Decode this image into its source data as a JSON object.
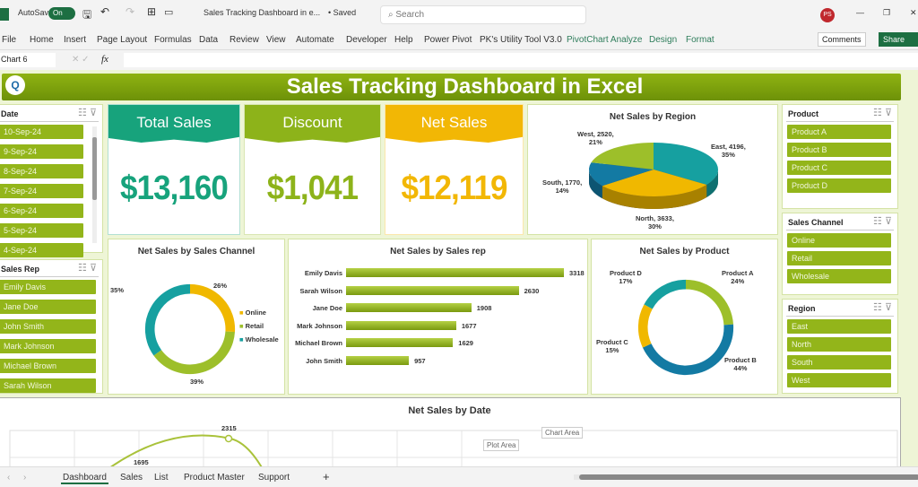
{
  "titlebar": {
    "app_icon": "excel-icon",
    "autosave_label": "AutoSave",
    "autosave_state": "On",
    "doc_title": "Sales Tracking Dashboard in e...",
    "saved_status": "• Saved",
    "search_placeholder": "Search",
    "user_initials": "PS"
  },
  "ribbon": {
    "tabs": [
      "File",
      "Home",
      "Insert",
      "Page Layout",
      "Formulas",
      "Data",
      "Review",
      "View",
      "Automate",
      "Developer",
      "Help",
      "Power Pivot",
      "PK's Utility Tool V3.0",
      "PivotChart Analyze",
      "Design",
      "Format"
    ],
    "comments": "Comments",
    "share": "Share"
  },
  "formula_bar": {
    "name_box": "Chart 6",
    "fx": "fx",
    "value": ""
  },
  "dashboard": {
    "title": "Sales Tracking Dashboard in Excel",
    "logo": "QA",
    "kpis": [
      {
        "label": "Total Sales",
        "value": "$13,160",
        "color": "#17a37c"
      },
      {
        "label": "Discount",
        "value": "$1,041",
        "color": "#8db31a"
      },
      {
        "label": "Net Sales",
        "value": "$12,119",
        "color": "#f2b705"
      }
    ],
    "slicers": {
      "date": {
        "header": "Date",
        "items": [
          "10-Sep-24",
          "9-Sep-24",
          "8-Sep-24",
          "7-Sep-24",
          "6-Sep-24",
          "5-Sep-24",
          "4-Sep-24"
        ]
      },
      "sales_rep": {
        "header": "Sales Rep",
        "items": [
          "Emily Davis",
          "Jane Doe",
          "John Smith",
          "Mark Johnson",
          "Michael Brown",
          "Sarah Wilson"
        ]
      },
      "product": {
        "header": "Product",
        "items": [
          "Product A",
          "Product B",
          "Product C",
          "Product D"
        ]
      },
      "sales_channel": {
        "header": "Sales Channel",
        "items": [
          "Online",
          "Retail",
          "Wholesale"
        ]
      },
      "region": {
        "header": "Region",
        "items": [
          "East",
          "North",
          "South",
          "West"
        ]
      }
    }
  },
  "chart_data": [
    {
      "type": "pie",
      "title": "Net Sales by Region",
      "categories": [
        "East",
        "North",
        "South",
        "West"
      ],
      "values": [
        4196,
        3633,
        1770,
        2520
      ],
      "percent_labels": [
        "35%",
        "30%",
        "14%",
        "21%"
      ],
      "colors": [
        "#16a0a0",
        "#f0b800",
        "#137aa3",
        "#9dbf2a"
      ]
    },
    {
      "type": "pie",
      "title": "Net Sales by Sales Channel",
      "categories": [
        "Online",
        "Retail",
        "Wholesale"
      ],
      "values": [
        26,
        39,
        35
      ],
      "percent_labels": [
        "26%",
        "39%",
        "35%"
      ],
      "colors": [
        "#f0b800",
        "#9dbf2a",
        "#16a0a0"
      ],
      "legend": "right"
    },
    {
      "type": "bar",
      "title": "Net Sales by Sales rep",
      "categories": [
        "Emily Davis",
        "Sarah Wilson",
        "Jane Doe",
        "Mark Johnson",
        "Michael Brown",
        "John Smith"
      ],
      "values": [
        3318,
        2630,
        1908,
        1677,
        1629,
        957
      ],
      "orientation": "horizontal"
    },
    {
      "type": "pie",
      "title": "Net Sales by Product",
      "categories": [
        "Product A",
        "Product B",
        "Product C",
        "Product D"
      ],
      "values": [
        24,
        44,
        15,
        17
      ],
      "percent_labels": [
        "24%",
        "44%",
        "15%",
        "17%"
      ],
      "colors": [
        "#9dbf2a",
        "#137aa3",
        "#f0b800",
        "#16a0a0"
      ]
    },
    {
      "type": "line",
      "title": "Net Sales  by Date",
      "point_labels": [
        "1695",
        "2315"
      ],
      "tooltips": [
        "Plot Area",
        "Chart Area"
      ]
    }
  ],
  "sheet_tabs": [
    "Dashboard",
    "Sales",
    "List",
    "Product Master",
    "Support"
  ],
  "active_tab": "Dashboard"
}
